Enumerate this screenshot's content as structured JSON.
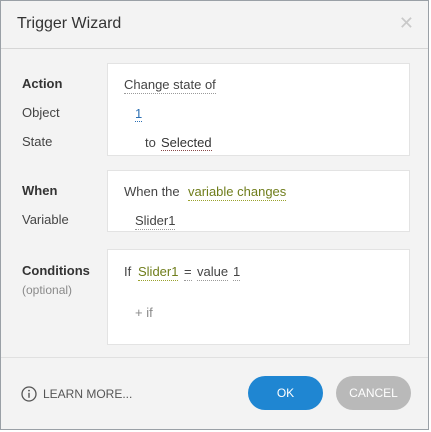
{
  "dialog": {
    "title": "Trigger Wizard",
    "close_symbol": "✕"
  },
  "action_section": {
    "action_label": "Action",
    "object_label": "Object",
    "state_label": "State",
    "action_value": "Change state of",
    "object_value": "1",
    "state_prefix": "to",
    "state_value": "Selected"
  },
  "when_section": {
    "when_label": "When",
    "variable_label": "Variable",
    "when_prefix": "When the",
    "when_value": "variable changes",
    "variable_value": "Slider1"
  },
  "conditions_section": {
    "conditions_label": "Conditions",
    "optional_label": "(optional)",
    "if_word": "If",
    "cond_variable": "Slider1",
    "cond_operator": "=",
    "cond_type": "value",
    "cond_value": "1",
    "add_if": "+ if"
  },
  "footer": {
    "learn_more": "LEARN MORE...",
    "ok_label": "OK",
    "cancel_label": "CANCEL",
    "icon": "info-icon"
  },
  "colors": {
    "ok_button": "#1f86d2",
    "cancel_button": "#b9b9b9",
    "link_olive": "#6f7d1b",
    "link_blue": "#2c6fb3"
  }
}
